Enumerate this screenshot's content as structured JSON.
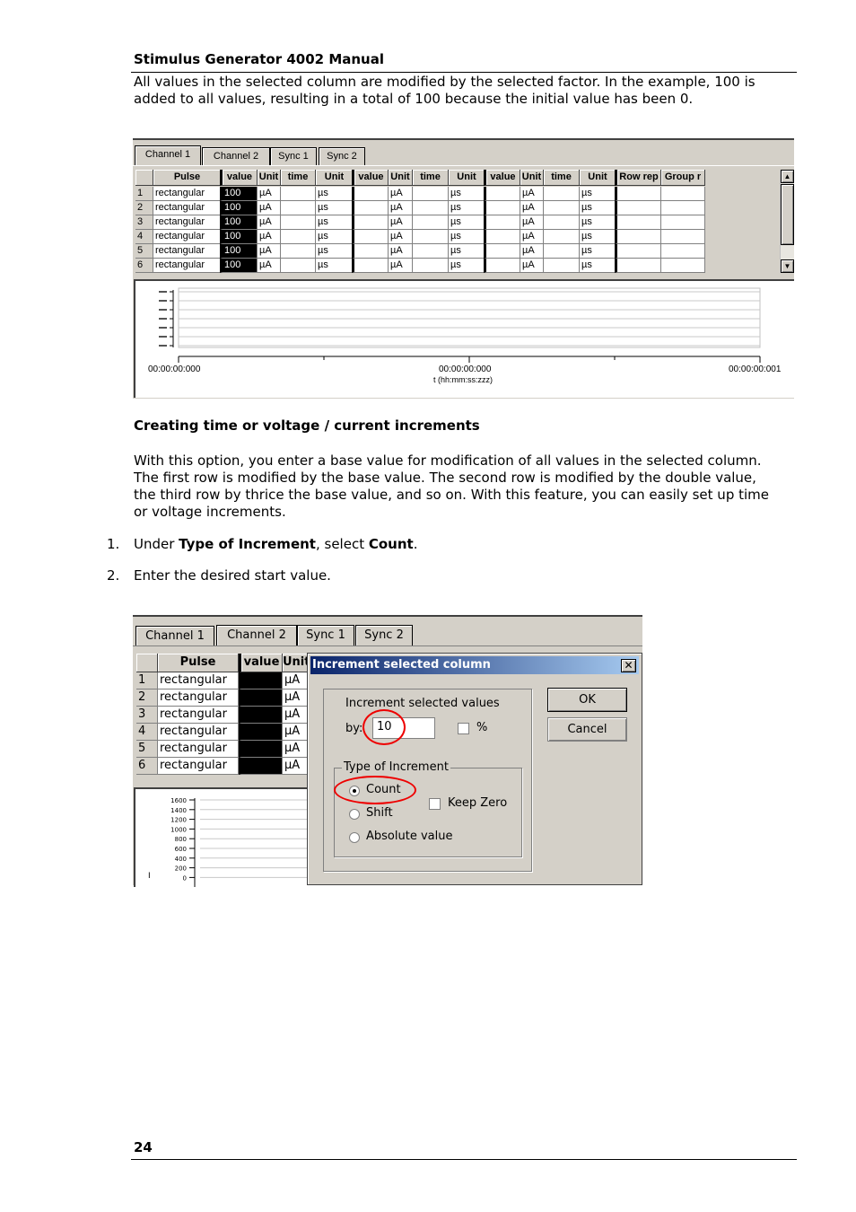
{
  "header": {
    "title": "Stimulus Generator 4002 Manual"
  },
  "intro": "All values in the selected column are modified by the selected factor. In the example, 100 is added to all values, resulting in a total of 100 because the initial value has been 0.",
  "shot1": {
    "tabs": [
      "Channel 1",
      "Channel 2",
      "Sync 1",
      "Sync 2"
    ],
    "columns": [
      "",
      "Pulse",
      "value",
      "Unit",
      "time",
      "Unit",
      "value",
      "Unit",
      "time",
      "Unit",
      "value",
      "Unit",
      "time",
      "Unit",
      "Row rep",
      "Group r"
    ],
    "rows": [
      [
        "1",
        "rectangular",
        "100",
        "µA",
        "",
        "µs",
        "",
        "µA",
        "",
        "µs",
        "",
        "µA",
        "",
        "µs",
        "",
        ""
      ],
      [
        "2",
        "rectangular",
        "100",
        "µA",
        "",
        "µs",
        "",
        "µA",
        "",
        "µs",
        "",
        "µA",
        "",
        "µs",
        "",
        ""
      ],
      [
        "3",
        "rectangular",
        "100",
        "µA",
        "",
        "µs",
        "",
        "µA",
        "",
        "µs",
        "",
        "µA",
        "",
        "µs",
        "",
        ""
      ],
      [
        "4",
        "rectangular",
        "100",
        "µA",
        "",
        "µs",
        "",
        "µA",
        "",
        "µs",
        "",
        "µA",
        "",
        "µs",
        "",
        ""
      ],
      [
        "5",
        "rectangular",
        "100",
        "µA",
        "",
        "µs",
        "",
        "µA",
        "",
        "µs",
        "",
        "µA",
        "",
        "µs",
        "",
        ""
      ],
      [
        "6",
        "rectangular",
        "100",
        "µA",
        "",
        "µs",
        "",
        "µA",
        "",
        "µs",
        "",
        "µA",
        "",
        "µs",
        "",
        ""
      ]
    ],
    "chart": {
      "x_ticks": [
        "00:00:00:000",
        "00:00:00:000",
        "00:00:00:001"
      ],
      "xlabel": "t (hh:mm:ss:zzz)"
    }
  },
  "section": {
    "title": "Creating time or voltage / current increments",
    "body": "With this option, you enter a base value for modification of all values in the selected column. The first row is modified by the base value. The second row is modified by the double value, the third row by thrice the base value, and so on. With this feature, you can easily set up time or voltage increments.",
    "steps": [
      {
        "num": "1.",
        "pre": "Under ",
        "b1": "Type of Increment",
        "mid": ", select ",
        "b2": "Count",
        "post": "."
      },
      {
        "num": "2.",
        "text": "Enter the desired start value."
      }
    ]
  },
  "shot2": {
    "tabs": [
      "Channel 1",
      "Channel 2",
      "Sync 1",
      "Sync 2"
    ],
    "columns": [
      "",
      "Pulse",
      "value",
      "Unit"
    ],
    "rows": [
      [
        "1",
        "rectangular",
        "",
        "µA"
      ],
      [
        "2",
        "rectangular",
        "",
        "µA"
      ],
      [
        "3",
        "rectangular",
        "",
        "µA"
      ],
      [
        "4",
        "rectangular",
        "",
        "µA"
      ],
      [
        "5",
        "rectangular",
        "",
        "µA"
      ],
      [
        "6",
        "rectangular",
        "",
        "µA"
      ]
    ],
    "y_ticks": [
      "1600",
      "1400",
      "1200",
      "1000",
      "800",
      "600",
      "400",
      "200",
      "0"
    ],
    "dialog": {
      "title": "Increment selected column",
      "group_label": "Increment selected values",
      "by_label": "by:",
      "by_value": "10",
      "percent_label": "%",
      "type_label": "Type of Increment",
      "options": [
        "Count",
        "Shift",
        "Absolute value"
      ],
      "selected": "Count",
      "keep_zero": "Keep Zero",
      "ok": "OK",
      "cancel": "Cancel"
    }
  },
  "footer": {
    "page": "24"
  }
}
